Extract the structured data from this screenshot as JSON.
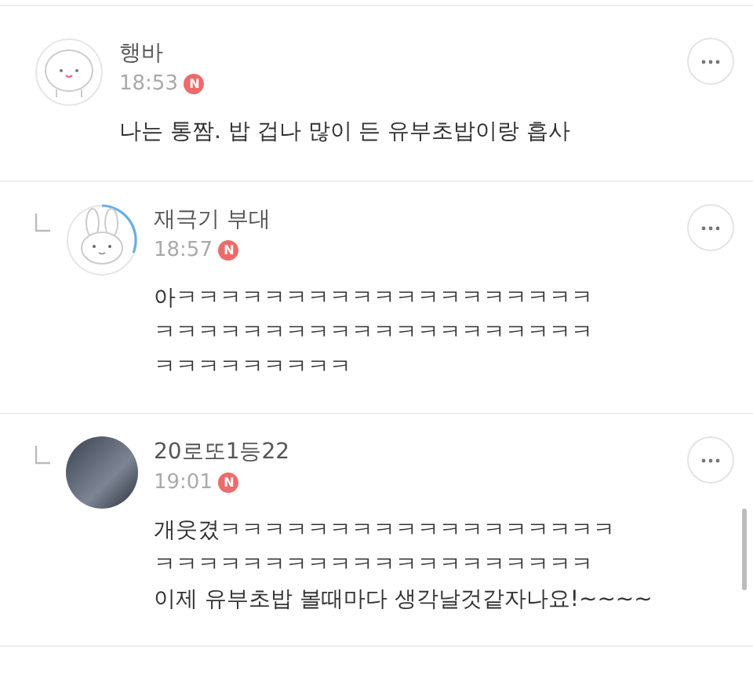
{
  "comments": [
    {
      "kind": "top",
      "avatar": {
        "kind": "blob"
      },
      "author": "행바",
      "time": "18:53",
      "badge": "N",
      "lines": [
        "나는 통짬. 밥 겁나 많이 든 유부초밥이랑 흡사"
      ]
    },
    {
      "kind": "reply",
      "avatar": {
        "kind": "rabbit"
      },
      "author": "재극기 부대",
      "time": "18:57",
      "badge": "N",
      "lines": [
        "아ㅋㅋㅋㅋㅋㅋㅋㅋㅋㅋㅋㅋㅋㅋㅋㅋㅋㅋㅋ",
        "ㅋㅋㅋㅋㅋㅋㅋㅋㅋㅋㅋㅋㅋㅋㅋㅋㅋㅋㅋㅋ",
        "ㅋㅋㅋㅋㅋㅋㅋㅋㅋ"
      ]
    },
    {
      "kind": "reply",
      "avatar": {
        "kind": "photo"
      },
      "author": "20로또1등22",
      "time": "19:01",
      "badge": "N",
      "lines": [
        "개웃겼ㅋㅋㅋㅋㅋㅋㅋㅋㅋㅋㅋㅋㅋㅋㅋㅋㅋㅋ",
        "ㅋㅋㅋㅋㅋㅋㅋㅋㅋㅋㅋㅋㅋㅋㅋㅋㅋㅋㅋㅋ",
        "이제 유부초밥 볼때마다 생각날것같자나요!~~~~"
      ]
    }
  ]
}
